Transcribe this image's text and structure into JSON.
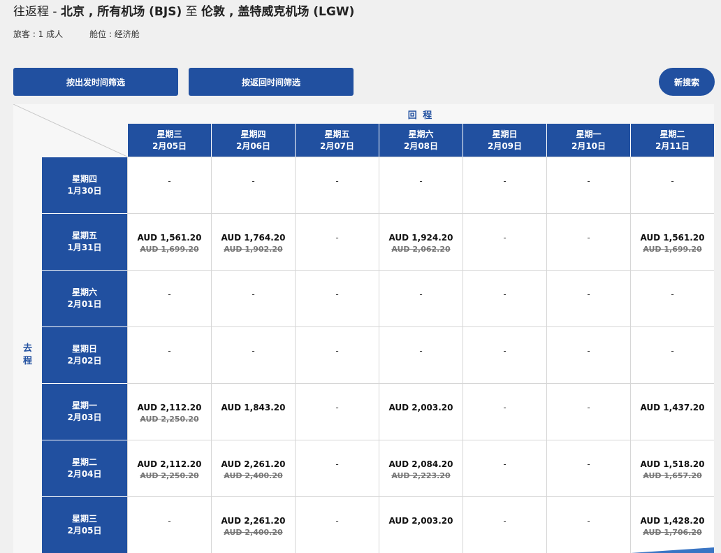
{
  "header": {
    "trip_type": "往返程 - ",
    "origin": "北京 , 所有机场 (BJS)",
    "connector": " 至 ",
    "destination": "伦敦 , 盖特威克机场 (LGW)",
    "passengers": "旅客 : 1 成人",
    "cabin": "舱位 : 经济舱"
  },
  "buttons": {
    "filter_depart": "按出发时间筛选",
    "filter_return": "按返回时间筛选",
    "new_search": "新搜索"
  },
  "grid": {
    "return_label": "回 程",
    "depart_label": [
      "去",
      "程"
    ],
    "columns": [
      {
        "weekday": "星期三",
        "date": "2月05日"
      },
      {
        "weekday": "星期四",
        "date": "2月06日"
      },
      {
        "weekday": "星期五",
        "date": "2月07日"
      },
      {
        "weekday": "星期六",
        "date": "2月08日"
      },
      {
        "weekday": "星期日",
        "date": "2月09日"
      },
      {
        "weekday": "星期一",
        "date": "2月10日"
      },
      {
        "weekday": "星期二",
        "date": "2月11日"
      }
    ],
    "rows": [
      {
        "weekday": "星期四",
        "date": "1月30日",
        "cells": [
          {
            "price": "-"
          },
          {
            "price": "-"
          },
          {
            "price": "-"
          },
          {
            "price": "-"
          },
          {
            "price": "-"
          },
          {
            "price": "-"
          },
          {
            "price": "-"
          }
        ]
      },
      {
        "weekday": "星期五",
        "date": "1月31日",
        "cells": [
          {
            "price": "AUD 1,561.20",
            "old": "AUD 1,699.20"
          },
          {
            "price": "AUD 1,764.20",
            "old": "AUD 1,902.20"
          },
          {
            "price": "-"
          },
          {
            "price": "AUD 1,924.20",
            "old": "AUD 2,062.20"
          },
          {
            "price": "-"
          },
          {
            "price": "-"
          },
          {
            "price": "AUD 1,561.20",
            "old": "AUD 1,699.20"
          }
        ]
      },
      {
        "weekday": "星期六",
        "date": "2月01日",
        "cells": [
          {
            "price": "-"
          },
          {
            "price": "-"
          },
          {
            "price": "-"
          },
          {
            "price": "-"
          },
          {
            "price": "-"
          },
          {
            "price": "-"
          },
          {
            "price": "-"
          }
        ]
      },
      {
        "weekday": "星期日",
        "date": "2月02日",
        "cells": [
          {
            "price": "-"
          },
          {
            "price": "-"
          },
          {
            "price": "-"
          },
          {
            "price": "-"
          },
          {
            "price": "-"
          },
          {
            "price": "-"
          },
          {
            "price": "-"
          }
        ]
      },
      {
        "weekday": "星期一",
        "date": "2月03日",
        "cells": [
          {
            "price": "AUD 2,112.20",
            "old": "AUD 2,250.20"
          },
          {
            "price": "AUD 1,843.20"
          },
          {
            "price": "-"
          },
          {
            "price": "AUD 2,003.20"
          },
          {
            "price": "-"
          },
          {
            "price": "-"
          },
          {
            "price": "AUD 1,437.20"
          }
        ]
      },
      {
        "weekday": "星期二",
        "date": "2月04日",
        "cells": [
          {
            "price": "AUD 2,112.20",
            "old": "AUD 2,250.20"
          },
          {
            "price": "AUD 2,261.20",
            "old": "AUD 2,400.20"
          },
          {
            "price": "-"
          },
          {
            "price": "AUD 2,084.20",
            "old": "AUD 2,223.20"
          },
          {
            "price": "-"
          },
          {
            "price": "-"
          },
          {
            "price": "AUD 1,518.20",
            "old": "AUD 1,657.20"
          }
        ]
      },
      {
        "weekday": "星期三",
        "date": "2月05日",
        "cells": [
          {
            "price": "-"
          },
          {
            "price": "AUD 2,261.20",
            "old": "AUD 2,400.20"
          },
          {
            "price": "-"
          },
          {
            "price": "AUD 2,003.20"
          },
          {
            "price": "-"
          },
          {
            "price": "-"
          },
          {
            "price": "AUD 1,428.20",
            "old": "AUD 1,706.20",
            "selected": true
          }
        ]
      }
    ]
  },
  "colors": {
    "brand_blue": "#2150a0",
    "selected_accent": "#3a75c4"
  }
}
